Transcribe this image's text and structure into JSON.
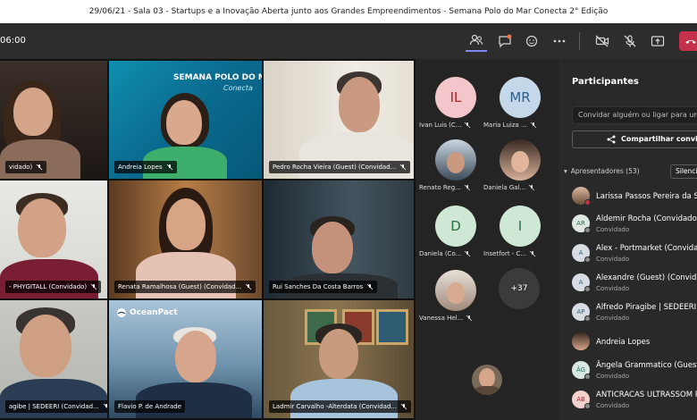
{
  "window": {
    "title": "29/06/21 - Sala 03 - Startups e a Inovação Aberta junto aos Grandes Empreendimentos - Semana Polo do Mar Conecta 2° Edição"
  },
  "toolbar": {
    "timer": "06:00",
    "icons": [
      "people-icon",
      "chat-icon",
      "reactions-icon",
      "more-icon",
      "camera-off-icon",
      "mic-off-icon",
      "share-icon",
      "leave-icon"
    ]
  },
  "video_tiles": [
    {
      "name": "vidado)"
    },
    {
      "name": "Andreia Lopes",
      "banner_line1": "SEMANA POLO DO MAR",
      "banner_line2": "Conecta"
    },
    {
      "name": "Pedro Rocha Vieira (Guest) (Convidad..."
    },
    {
      "name": "- PHYGITALL (Convidado)"
    },
    {
      "name": "Renata Ramalhosa (Guest) (Convidad..."
    },
    {
      "name": "Rui Sanches Da Costa Barros"
    },
    {
      "name": "agibe | SEDEERI (Convidad..."
    },
    {
      "name": "Flavio P. de Andrade",
      "logo": "OceanPact"
    },
    {
      "name": "Ladmir Carvalho -Alterdata (Convidad..."
    }
  ],
  "participant_grid": [
    {
      "initials": "IL",
      "name": "Ivan Luis (C...",
      "color": "#f3c6cc",
      "text_color": "#a4262c"
    },
    {
      "initials": "MR",
      "name": "Maria Luiza ...",
      "color": "#c5d8ea",
      "text_color": "#2b5f8a"
    },
    {
      "initials": "",
      "name": "Renato Reg..."
    },
    {
      "initials": "",
      "name": "Daniela Gal..."
    },
    {
      "initials": "D",
      "name": "Daniela (Co...",
      "color": "#cfe8d6",
      "text_color": "#287043"
    },
    {
      "initials": "I",
      "name": "Insetfort - C...",
      "color": "#cfe8d6",
      "text_color": "#287043"
    },
    {
      "initials": "",
      "name": "Vanessa Hel..."
    }
  ],
  "more_count": "+37",
  "panel": {
    "title": "Participantes",
    "invite_placeholder": "Convidar alguém ou ligar para um",
    "share_label": "Compartilhar convite",
    "section_label": "Apresentadores (53)",
    "silence_label": "Silenciar",
    "participants": [
      {
        "initials": "",
        "name": "Larissa Passos Pereira da Silva",
        "sub": ""
      },
      {
        "initials": "AR",
        "name": "Aldemir Rocha (Convidado)",
        "sub": "Convidado"
      },
      {
        "initials": "A",
        "name": "Alex - Portmarket (Convidado)",
        "sub": "Convidado"
      },
      {
        "initials": "A",
        "name": "Alexandre (Guest) (Convidado)",
        "sub": "Convidado"
      },
      {
        "initials": "AP",
        "name": "Alfredo Piragibe | SEDEERI (C",
        "sub": "Convidado"
      },
      {
        "initials": "",
        "name": "Andreia Lopes",
        "sub": ""
      },
      {
        "initials": "ÂG",
        "name": "Ângela Grammatico (Guest)",
        "sub": "Convidado"
      },
      {
        "initials": "AB",
        "name": "ANTICRACAS ULTRASSOM PA",
        "sub": "Convidado"
      }
    ]
  },
  "colors": {
    "accent": "#7f85f5",
    "leave": "#c4314b",
    "panel_bg": "#292929"
  }
}
